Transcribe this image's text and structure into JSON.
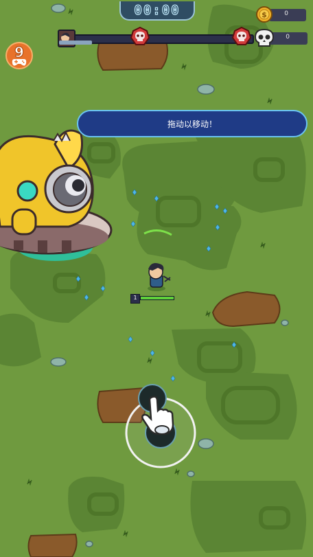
{
  "hud": {
    "timer": "00:00",
    "coins": "0",
    "kills": "0",
    "level": "9",
    "wave_progress": 0,
    "player_tag": "Lv.1"
  },
  "hint": {
    "text": "拖动以移动！"
  },
  "player": {
    "level": "1",
    "hp_fraction": 1.0
  },
  "icons": {
    "coin": "coin-icon",
    "skull": "skull-icon",
    "boss": "boss-skull-marker-icon",
    "gamepad": "gamepad-icon",
    "hand": "tap-hand-icon"
  },
  "colors": {
    "grass": "#6f9a3f",
    "grass_dark": "#567f2f",
    "dirt": "#8a5a2b",
    "hint_bg": "#1f3b86",
    "hint_border": "#6bc4f2",
    "gem": "#4fb6e8",
    "badge": "#e8722a",
    "hp": "#5fd13a"
  }
}
